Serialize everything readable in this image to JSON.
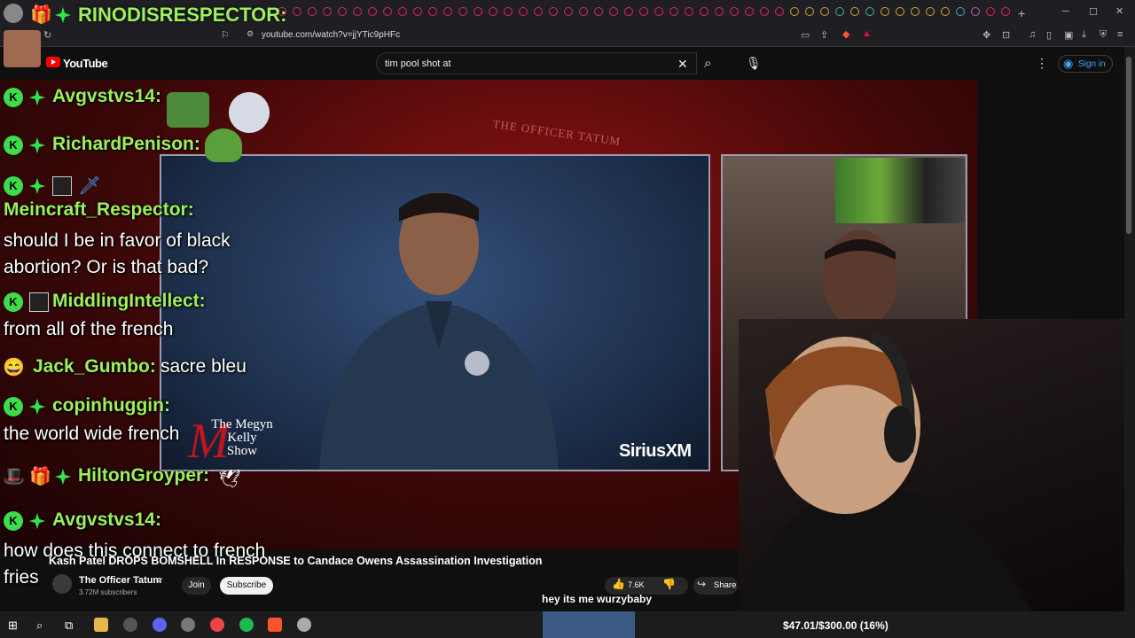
{
  "browser": {
    "url": "youtube.com/watch?v=jjYTic9pHFc"
  },
  "youtube": {
    "logo_text": "YouTube",
    "search_value": "tim pool shot at",
    "sign_in_label": "Sign in"
  },
  "video": {
    "title": "Kash Patel DROPS BOMSHELL In RESPONSE to Candace Owens Assassination Investigation",
    "channel_name": "The Officer Tatum",
    "subscribers": "3.72M subscribers",
    "join_label": "Join",
    "subscribe_label": "Subscribe",
    "likes": "7.6K",
    "share_label": "Share",
    "watermark": "SiriusXM",
    "show_logo_text": "The Megyn Kelly Show",
    "banner_text": "THE OFFICER TATUM",
    "caption": "hey its me wurzybaby"
  },
  "chat": {
    "top_user": "RINODISRESPECTOR:",
    "messages": [
      {
        "user": "Avgvstvs14:",
        "text": ""
      },
      {
        "user": "RichardPenison:",
        "text": ""
      },
      {
        "user": "Meincraft_Respector:",
        "text": "should I be in favor of black abortion? Or is that bad?"
      },
      {
        "user": "MiddlingIntellect:",
        "text": "from all of the french"
      },
      {
        "user": "Jack_Gumbo:",
        "text": "sacre bleu"
      },
      {
        "user": "copinhuggin:",
        "text": "the world wide french"
      },
      {
        "user": "HiltonGroyper:",
        "text": ""
      },
      {
        "user": "Avgvstvs14:",
        "text": "how does this connect to french fries"
      }
    ]
  },
  "stream": {
    "goal": "$47.01/$300.00 (16%)"
  }
}
